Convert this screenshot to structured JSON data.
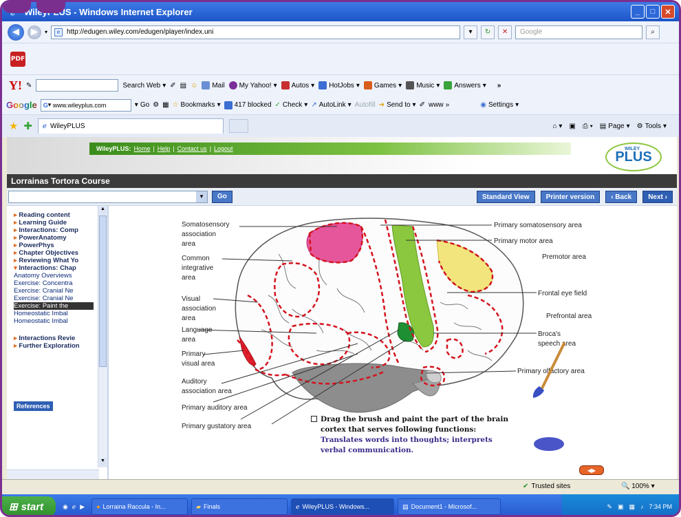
{
  "window": {
    "title": "WileyPLUS - Windows Internet Explorer"
  },
  "address_bar": {
    "url": "http://edugen.wiley.com/edugen/player/index.uni",
    "search_placeholder": "Google"
  },
  "yahoo_toolbar": {
    "logo": "Y!",
    "search_button": "Search Web",
    "items": [
      "Mail",
      "My Yahoo!",
      "Autos",
      "HotJobs",
      "Games",
      "Music",
      "Answers"
    ],
    "more": "»"
  },
  "google_toolbar": {
    "logo": "Google",
    "search_value": "www.wileyplus.com",
    "go": "Go",
    "items": [
      "Bookmarks",
      "417 blocked",
      "Check",
      "AutoLink",
      "Autofill",
      "Send to",
      "www"
    ],
    "settings": "Settings"
  },
  "tabs": {
    "active_tab": "WileyPLUS",
    "commands": [
      "Page",
      "Tools"
    ]
  },
  "site": {
    "nav": [
      "WileyPLUS:",
      "Home",
      "|",
      "Help",
      "|",
      "Contact us",
      "|",
      "Logout"
    ],
    "logo_small": "WILEY",
    "logo": "PLUS",
    "course_title": "Lorrainas Tortora Course",
    "go_button": "Go",
    "standard_view": "Standard View",
    "printer_version": "Printer version",
    "back": "‹ Back",
    "next": "Next ›"
  },
  "sidebar": {
    "items": [
      {
        "label": "Reading content",
        "kind": "top"
      },
      {
        "label": "Learning Guide",
        "kind": "top"
      },
      {
        "label": "Interactions: Comp",
        "kind": "top"
      },
      {
        "label": "PowerAnatomy",
        "kind": "top"
      },
      {
        "label": "PowerPhys",
        "kind": "top"
      },
      {
        "label": "Chapter Objectives",
        "kind": "top"
      },
      {
        "label": "Reviewing What Yo",
        "kind": "top"
      },
      {
        "label": "Interactions: Chap",
        "kind": "open"
      },
      {
        "label": "Anatomy Overviews",
        "kind": "sub"
      },
      {
        "label": "Exercise: Concentra",
        "kind": "sub"
      },
      {
        "label": "Exercise: Cranial Ne",
        "kind": "sub"
      },
      {
        "label": "Exercise: Cranial Ne",
        "kind": "sub"
      },
      {
        "label": "Exercise: Paint the",
        "kind": "sel"
      },
      {
        "label": "Homeostatic Imbal",
        "kind": "sub"
      },
      {
        "label": "Homeostatic Imbal",
        "kind": "sub"
      },
      {
        "label": "",
        "kind": "gap"
      },
      {
        "label": "Interactions Revie",
        "kind": "top"
      },
      {
        "label": "Further Exploration",
        "kind": "top"
      }
    ],
    "references": "References"
  },
  "brain": {
    "labels_left": [
      "Somatosensory",
      "association",
      "area",
      "Common",
      "integrative",
      "area",
      "Visual",
      "association",
      "area",
      "Language",
      "area",
      "Primary",
      "visual area",
      "Auditory",
      "association area",
      "Primary auditory area",
      "Primary gustatory area"
    ],
    "labels_right": [
      "Primary somatosensory area",
      "Primary motor area",
      "Premotor area",
      "Frontal eye field",
      "Prefrontal area",
      "Broca's",
      "speech area",
      "Primary olfactory area"
    ],
    "colors": {
      "pink": "#e6569a",
      "green": "#8cc83f",
      "yellow": "#f2e57d",
      "red": "#e0202d",
      "dark_green": "#1f8f33",
      "gray": "#8d8d8d"
    }
  },
  "instructions": {
    "heading_1": "Drag the brush and paint the part of the brain",
    "heading_2": "cortex that serves following functions:",
    "task_1": "Translates words into thoughts; interprets",
    "task_2": "verbal communication."
  },
  "status": {
    "zone": "Trusted sites",
    "zoom": "100%"
  },
  "taskbar": {
    "start": "start",
    "buttons": [
      "Lorraina Raccula - In...",
      "Finals",
      "WileyPLUS - Windows...",
      "Document1 - Microsof..."
    ],
    "clock": "7:34 PM"
  }
}
